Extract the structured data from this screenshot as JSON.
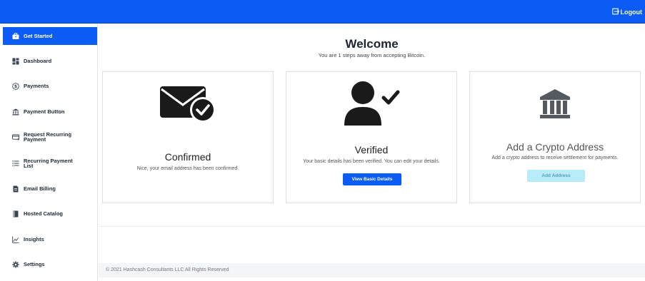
{
  "header": {
    "logout_label": "Logout",
    "accent_color": "#0b5cf5"
  },
  "sidebar": {
    "items": [
      {
        "label": "Get Started",
        "icon": "briefcase-icon",
        "active": true
      },
      {
        "label": "Dashboard",
        "icon": "dashboard-icon"
      },
      {
        "label": "Payments",
        "icon": "dollar-circle-icon"
      },
      {
        "label": "Payment Button",
        "icon": "bank-icon"
      },
      {
        "label": "Request Recurring Payment",
        "icon": "card-icon"
      },
      {
        "label": "Recurring Payment List",
        "icon": "list-icon"
      },
      {
        "label": "Email Billing",
        "icon": "document-icon"
      },
      {
        "label": "Hosted Catalog",
        "icon": "book-icon"
      },
      {
        "label": "Insights",
        "icon": "chart-icon"
      },
      {
        "label": "Settings",
        "icon": "gear-icon"
      }
    ]
  },
  "main": {
    "title": "Welcome",
    "subtitle": "You are 1 steps away from accepting Bitcoin.",
    "cards": [
      {
        "title": "Confirmed",
        "description": "Nice, your email address has been confirmed.",
        "icon": "email-check-icon"
      },
      {
        "title": "Verified",
        "description": "Your basic details has been verified. You can edit your details.",
        "icon": "user-check-icon",
        "button": "View Basic Details"
      },
      {
        "title": "Add a Crypto Address",
        "description": "Add a crypto address to receive settlement for payments.",
        "icon": "bank-icon",
        "button": "Add Address"
      }
    ]
  },
  "footer": {
    "copyright": "© 2021 Hashcash Consultants LLC All Rights Reserved"
  }
}
